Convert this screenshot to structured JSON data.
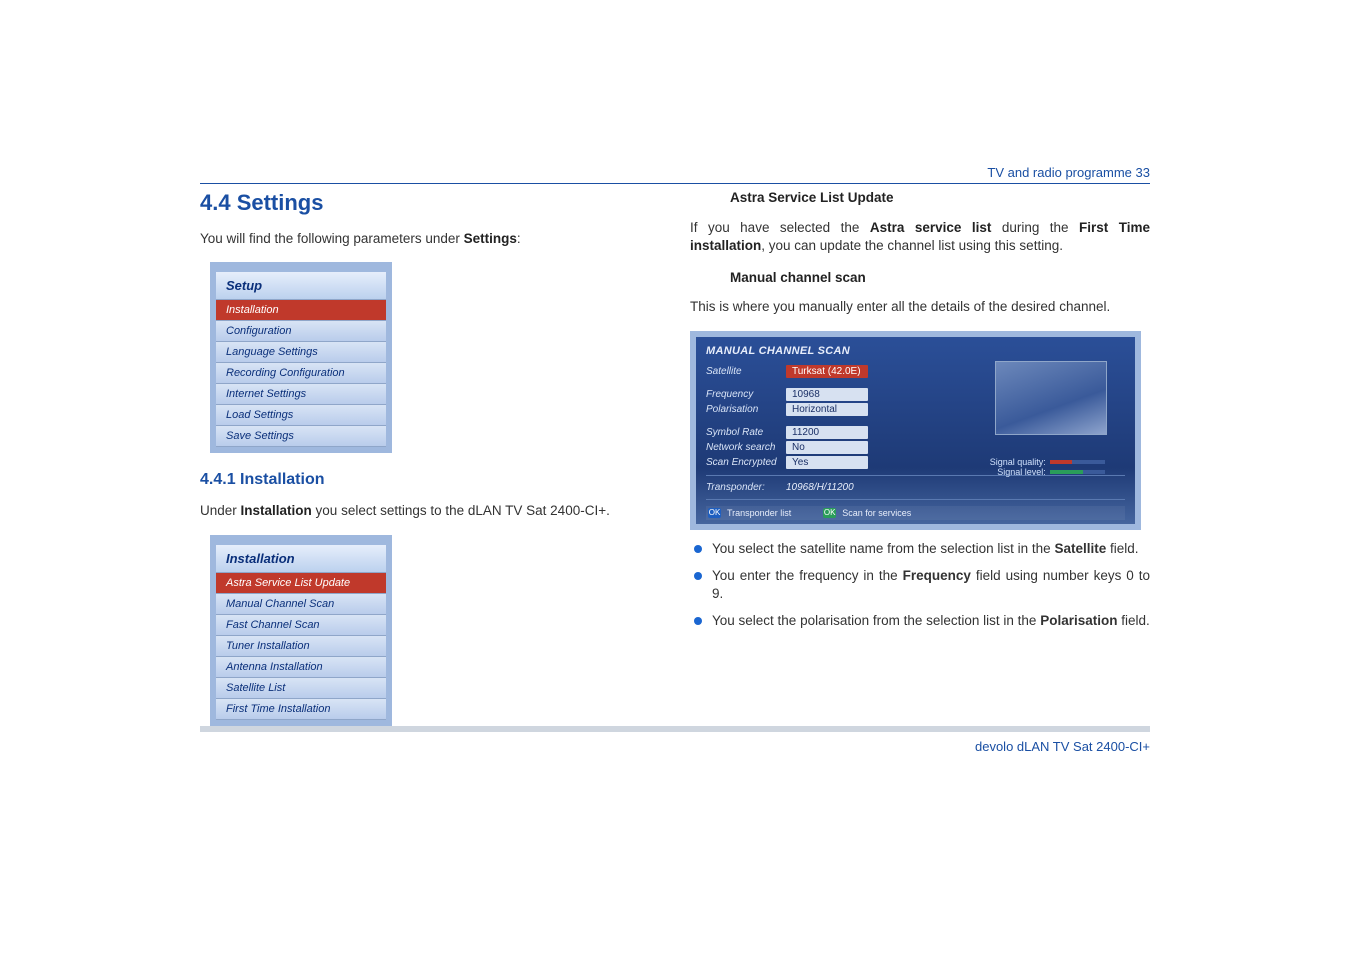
{
  "header": {
    "running": "TV and radio programme 33"
  },
  "footer": {
    "text": "devolo dLAN TV Sat 2400-CI+"
  },
  "left": {
    "h2": "4.4 Settings",
    "intro_pre": "You will find the following parameters under ",
    "intro_b": "Settings",
    "intro_post": ":",
    "setup_menu": {
      "title": "Setup",
      "items": [
        {
          "label": "Installation",
          "selected": true
        },
        {
          "label": "Configuration"
        },
        {
          "label": "Language Settings"
        },
        {
          "label": "Recording Configuration"
        },
        {
          "label": "Internet Settings"
        },
        {
          "label": "Load Settings"
        },
        {
          "label": "Save Settings"
        }
      ]
    },
    "h3": "4.4.1 Installation",
    "p441_pre": "Under ",
    "p441_b": "Installation",
    "p441_post": " you select settings to the dLAN TV Sat 2400-CI+.",
    "install_menu": {
      "title": "Installation",
      "items": [
        {
          "label": "Astra Service List Update",
          "selected": true
        },
        {
          "label": "Manual Channel Scan"
        },
        {
          "label": "Fast Channel Scan"
        },
        {
          "label": "Tuner Installation"
        },
        {
          "label": "Antenna Installation"
        },
        {
          "label": "Satellite List"
        },
        {
          "label": "First Time Installation"
        }
      ]
    }
  },
  "right": {
    "sub1": "Astra Service List Update",
    "p1_a": "If you have selected the ",
    "p1_b1": "Astra service list",
    "p1_c": " during the ",
    "p1_b2": "First Time installation",
    "p1_d": ", you can update the channel list using this setting.",
    "sub2": "Manual channel scan",
    "p2": "This is where you manually enter all the details of the desired channel.",
    "scan": {
      "title": "MANUAL CHANNEL SCAN",
      "rows": [
        {
          "label": "Satellite",
          "value": "Turksat (42.0E)",
          "selected": true
        },
        {
          "label": "Frequency",
          "value": "10968"
        },
        {
          "label": "Polarisation",
          "value": "Horizontal"
        },
        {
          "label": "Symbol Rate",
          "value": "11200"
        },
        {
          "label": "Network search",
          "value": "No"
        },
        {
          "label": "Scan Encrypted",
          "value": "Yes"
        }
      ],
      "transp_label": "Transponder:",
      "transp_value": "10968/H/11200",
      "sigq": "Signal quality:",
      "sigl": "Signal level:",
      "btn1": "Transponder list",
      "btn2": "Scan for services"
    },
    "bullets": [
      {
        "pre": "You select the satellite name from the selection list in the ",
        "b": "Satellite",
        "post": " field."
      },
      {
        "pre": "You enter the frequency in the ",
        "b": "Frequency",
        "post": " field using number keys 0 to 9."
      },
      {
        "pre": "You select the polarisation from the selection list in the ",
        "b": "Polarisation",
        "post": " field."
      }
    ]
  }
}
